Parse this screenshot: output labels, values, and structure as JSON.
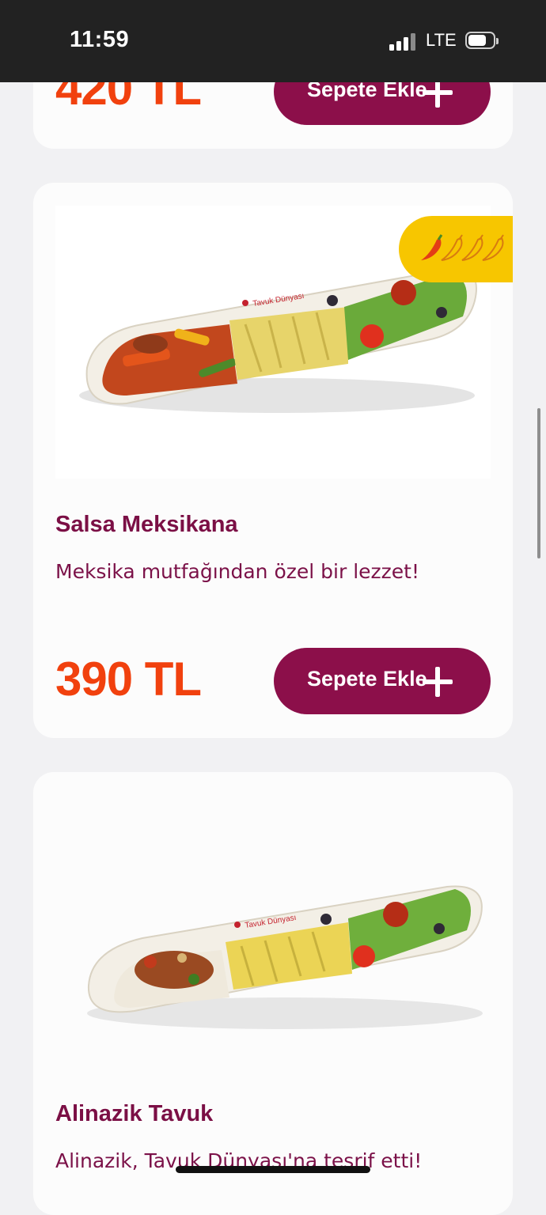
{
  "status_bar": {
    "time": "11:59",
    "network": "LTE"
  },
  "colors": {
    "price": "#f1410e",
    "button": "#8c0f4a",
    "title": "#7b0f45",
    "badge": "#f7c600"
  },
  "products": [
    {
      "price": "420 TL",
      "button_label": "Sepete Ekle",
      "button_icon": "plus-icon"
    },
    {
      "title": "Salsa Meksikana",
      "description": "Meksika mutfağından özel bir lezzet!",
      "price": "390 TL",
      "button_label": "Sepete Ekle",
      "button_icon": "plus-icon",
      "image_logo_text": "Tavuk Dünyası",
      "spice_level": 1,
      "spice_max": 4
    },
    {
      "title": "Alinazik Tavuk",
      "description": "Alinazik, Tavuk Dünyası'na teşrif etti!",
      "image_logo_text": "Tavuk Dünyası"
    }
  ]
}
